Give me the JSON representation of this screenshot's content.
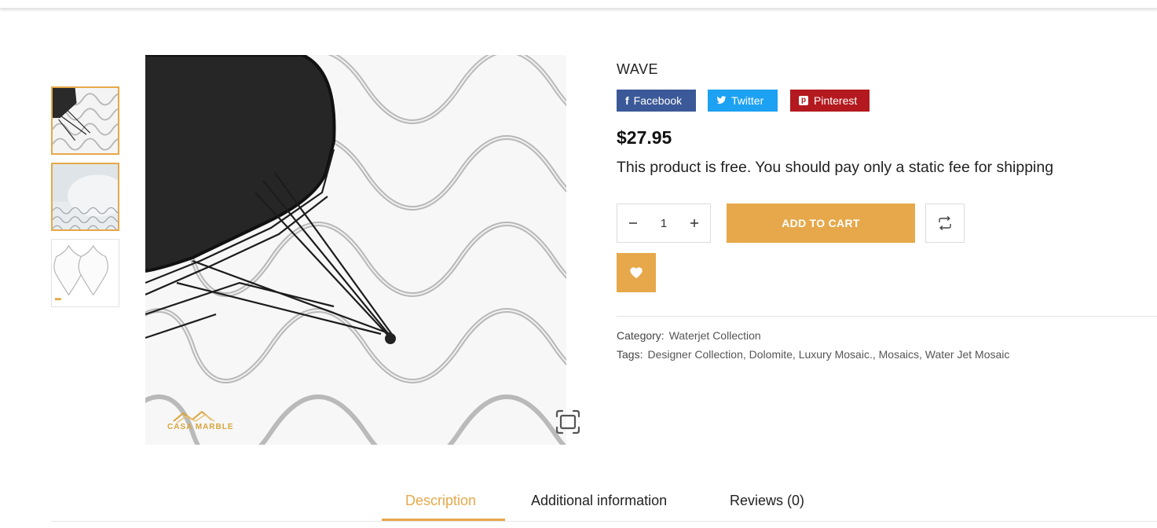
{
  "product": {
    "title": "WAVE",
    "price": "$27.95",
    "note": "This product is free. You should pay only a static fee for shipping",
    "quantity": "1"
  },
  "share": {
    "facebook": "Facebook",
    "twitter": "Twitter",
    "pinterest": "Pinterest"
  },
  "actions": {
    "add_to_cart": "ADD TO CART"
  },
  "meta": {
    "category_label": "Category:",
    "category": "Waterjet Collection",
    "tags_label": "Tags:",
    "tags": [
      "Designer Collection",
      "Dolomite",
      "Luxury Mosaic.",
      "Mosaics",
      "Water Jet Mosaic"
    ]
  },
  "image": {
    "logo_text": "CASA MARBLE"
  },
  "tabs": [
    {
      "label": "Description",
      "active": true
    },
    {
      "label": "Additional information",
      "active": false
    },
    {
      "label": "Reviews (0)",
      "active": false
    }
  ],
  "colors": {
    "accent": "#e6a84a",
    "facebook": "#3b5998",
    "twitter": "#1da1f2",
    "pinterest": "#b3191e"
  },
  "icons": {
    "zoom": "fullscreen-icon",
    "compare": "compare-arrows-icon",
    "wishlist": "heart-icon"
  }
}
